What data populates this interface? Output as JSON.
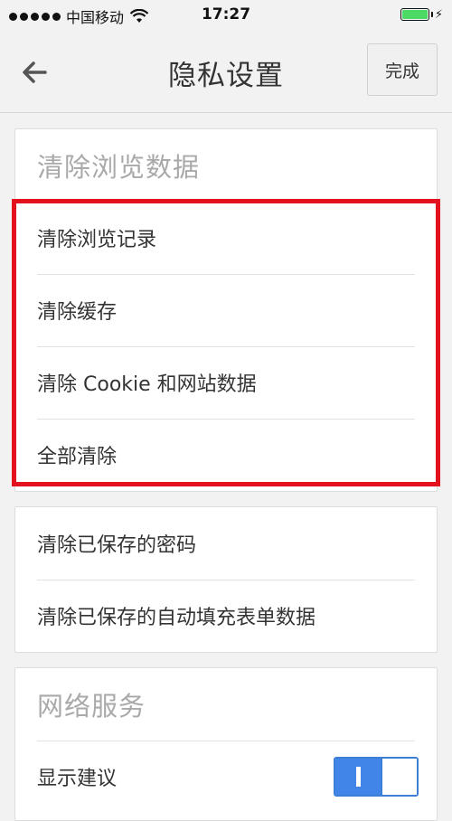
{
  "status_bar": {
    "carrier": "中国移动",
    "time": "17:27",
    "battery_color": "#4cd964"
  },
  "nav": {
    "back_icon": "arrow-left-icon",
    "title": "隐私设置",
    "done_label": "完成"
  },
  "clear_browsing": {
    "header": "清除浏览数据",
    "items": [
      {
        "label": "清除浏览记录"
      },
      {
        "label": "清除缓存"
      },
      {
        "label": "清除 Cookie 和网站数据"
      },
      {
        "label": "全部清除"
      }
    ]
  },
  "saved_data": {
    "items": [
      {
        "label": "清除已保存的密码"
      },
      {
        "label": "清除已保存的自动填充表单数据"
      }
    ]
  },
  "network": {
    "header": "网络服务",
    "items": [
      {
        "label": "显示建议",
        "toggle_on": true
      }
    ]
  },
  "colors": {
    "highlight": "#e3111d",
    "toggle_accent": "#4285e8"
  }
}
